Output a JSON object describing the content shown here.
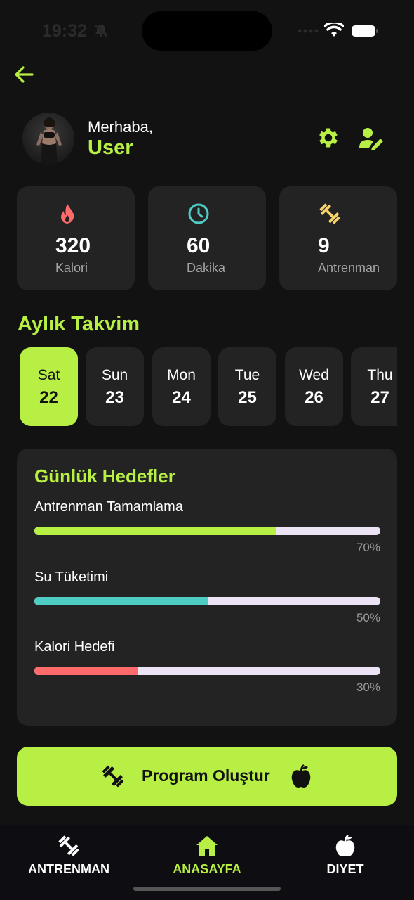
{
  "status_bar": {
    "time": "19:32"
  },
  "header": {
    "greeting": "Merhaba,",
    "username": "User"
  },
  "stats": [
    {
      "value": "320",
      "label": "Kalori",
      "icon": "flame-icon",
      "color": "#ff6b6b"
    },
    {
      "value": "60",
      "label": "Dakika",
      "icon": "clock-icon",
      "color": "#4ecdc4"
    },
    {
      "value": "9",
      "label": "Antrenman",
      "icon": "dumbbell-icon",
      "color": "#f7d26a"
    }
  ],
  "calendar": {
    "title": "Aylık Takvim",
    "days": [
      {
        "name": "Sat",
        "num": "22",
        "active": true
      },
      {
        "name": "Sun",
        "num": "23"
      },
      {
        "name": "Mon",
        "num": "24"
      },
      {
        "name": "Tue",
        "num": "25"
      },
      {
        "name": "Wed",
        "num": "26"
      },
      {
        "name": "Thu",
        "num": "27"
      }
    ]
  },
  "goals": {
    "title": "Günlük Hedefler",
    "items": [
      {
        "label": "Antrenman Tamamlama",
        "percent_text": "70%",
        "value": 0.7,
        "color": "#b8ef45"
      },
      {
        "label": "Su Tüketimi",
        "percent_text": "50%",
        "value": 0.5,
        "color": "#4ecdc4"
      },
      {
        "label": "Kalori Hedefi",
        "percent_text": "30%",
        "value": 0.3,
        "color": "#ff6b6b"
      }
    ]
  },
  "cta": {
    "label": "Program Oluştur"
  },
  "nav": {
    "items": [
      {
        "label": "ANTRENMAN",
        "icon": "dumbbell-icon"
      },
      {
        "label": "ANASAYFA",
        "icon": "home-icon",
        "active": true
      },
      {
        "label": "DIYET",
        "icon": "apple-icon"
      }
    ]
  },
  "colors": {
    "accent": "#b8ef45",
    "background": "#121212",
    "card": "#232323"
  }
}
